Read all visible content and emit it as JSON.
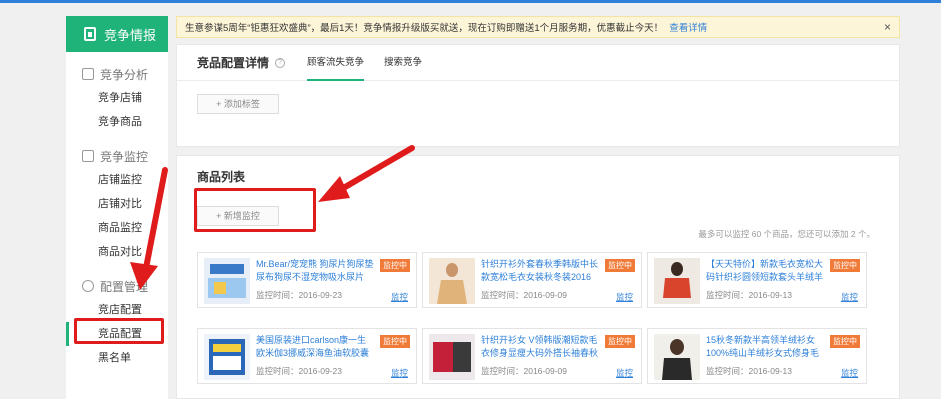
{
  "sidebar": {
    "brand": "竞争情报",
    "groups": [
      {
        "title": "竞争分析",
        "icon": "chart-box-icon",
        "items": [
          "竞争店铺",
          "竞争商品"
        ]
      },
      {
        "title": "竞争监控",
        "icon": "monitor-box-icon",
        "items": [
          "店铺监控",
          "店铺对比",
          "商品监控",
          "商品对比"
        ]
      },
      {
        "title": "配置管理",
        "icon": "gear-icon",
        "items": [
          "竞店配置",
          "竞品配置",
          "黑名单"
        ]
      }
    ],
    "active_item": "竞品配置"
  },
  "notice": {
    "text": "生意参谋5周年“钜惠狂欢盛典”，最后1天！竞争情报升级版买就送，现在订购即赠送1个月服务期，优惠截止今天！",
    "link": "查看详情",
    "close": "×"
  },
  "config": {
    "title": "竞品配置详情",
    "help": "?",
    "tabs": [
      "顾客流失竞争",
      "搜索竞争"
    ],
    "active_tab": "顾客流失竞争",
    "add_tag_button": "+ 添加标签"
  },
  "products_section": {
    "title": "商品列表",
    "add_button": "+ 新增监控",
    "limit_text": "最多可以监控 60 个商品，您还可以添加 2 个。",
    "items": [
      {
        "title": "Mr.Bear/宠宠熊 狗尿片狗尿垫尿布狗尿不湿宠物吸水尿片",
        "time": "监控时间：2016-09-23",
        "badge": "监控中",
        "link": "监控"
      },
      {
        "title": "针织开衫外套春秋季韩版中长款宽松毛衣女装秋冬装2016",
        "time": "监控时间：2016-09-09",
        "badge": "监控中",
        "link": "监控"
      },
      {
        "title": "【天天特价】新款毛衣宽松大码针织衫圆领短款套头羊绒羊",
        "time": "监控时间：2016-09-13",
        "badge": "监控中",
        "link": "监控"
      },
      {
        "title": "美国原装进口carlson康一生欧米伽3挪威深海鱼油软胶囊",
        "time": "监控时间：2016-09-23",
        "badge": "监控中",
        "link": "监控"
      },
      {
        "title": "针织开衫女 V领韩版潮短款毛衣修身显瘦大码外搭长袖春秋",
        "time": "监控时间：2016-09-09",
        "badge": "监控中",
        "link": "监控"
      },
      {
        "title": "15秋冬新款半高领羊绒衫女100%纯山羊绒衫女式修身毛",
        "time": "监控时间：2016-09-13",
        "badge": "监控中",
        "link": "监控"
      }
    ]
  },
  "colors": {
    "brand": "#1fb37a",
    "link": "#2f80d8",
    "badge": "#f07b39",
    "annotation": "#e01b1b"
  }
}
